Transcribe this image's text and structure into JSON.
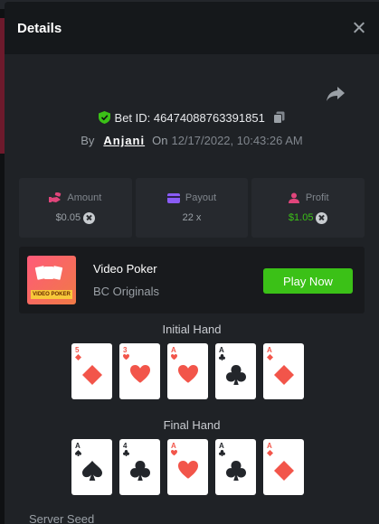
{
  "header": {
    "title": "Details"
  },
  "bet": {
    "label": "Bet ID:",
    "id": "46474088763391851",
    "by_label": "By",
    "user": "Anjani",
    "on_label": "On",
    "datetime": "12/17/2022, 10:43:26 AM"
  },
  "stats": [
    {
      "label": "Amount",
      "value": "$0.05",
      "icon": "hand-coins-icon",
      "icon_color": "#e0457b",
      "has_coin": true,
      "green": false
    },
    {
      "label": "Payout",
      "value": "22 x",
      "icon": "wallet-icon",
      "icon_color": "#8a5cf6",
      "has_coin": false,
      "green": false
    },
    {
      "label": "Profit",
      "value": "$1.05",
      "icon": "profit-icon",
      "icon_color": "#e0457b",
      "has_coin": true,
      "green": true
    }
  ],
  "game": {
    "name": "Video Poker",
    "provider": "BC Originals",
    "thumb_label": "VIDEO POKER",
    "play_label": "Play Now"
  },
  "initial_hand": {
    "title": "Initial Hand",
    "cards": [
      {
        "rank": "5",
        "suit": "diamond"
      },
      {
        "rank": "3",
        "suit": "heart"
      },
      {
        "rank": "A",
        "suit": "heart"
      },
      {
        "rank": "A",
        "suit": "club"
      },
      {
        "rank": "A",
        "suit": "diamond"
      }
    ]
  },
  "final_hand": {
    "title": "Final Hand",
    "cards": [
      {
        "rank": "A",
        "suit": "spade"
      },
      {
        "rank": "4",
        "suit": "club"
      },
      {
        "rank": "A",
        "suit": "heart"
      },
      {
        "rank": "A",
        "suit": "club"
      },
      {
        "rank": "A",
        "suit": "diamond"
      }
    ]
  },
  "server_seed_label": "Server Seed",
  "colors": {
    "accent_green": "#3bc117",
    "panel": "#1f2226",
    "card_red": "#f2554a"
  }
}
